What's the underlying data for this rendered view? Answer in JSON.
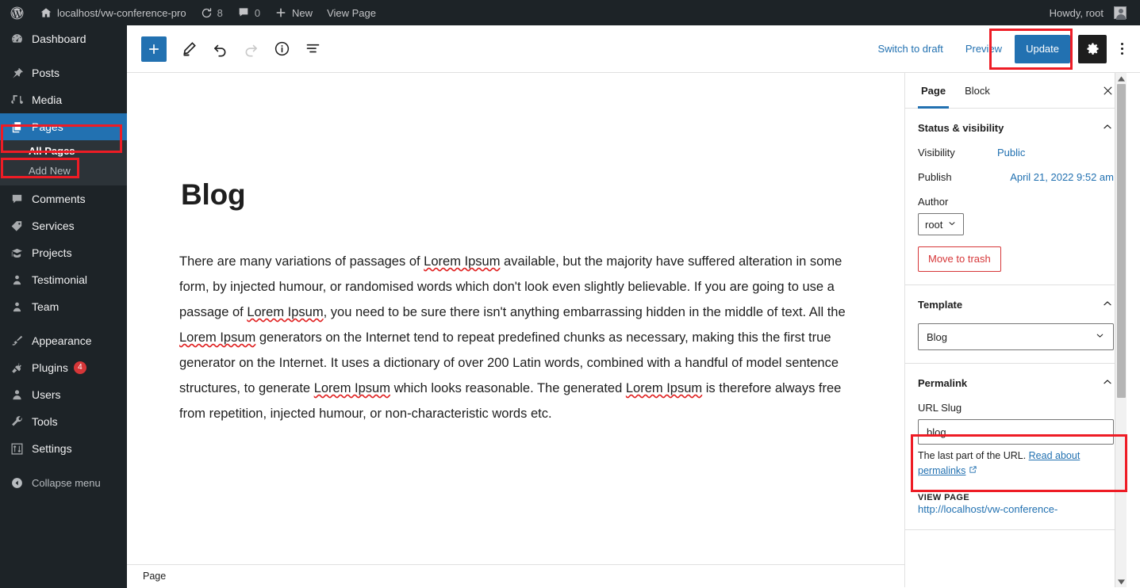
{
  "adminbar": {
    "site_name": "localhost/vw-conference-pro",
    "updates_count": "8",
    "comments_count": "0",
    "new_label": "New",
    "view_page_label": "View Page",
    "howdy": "Howdy, root"
  },
  "adminmenu": {
    "items": [
      {
        "label": "Dashboard",
        "icon": "dashboard-icon"
      },
      {
        "label": "Posts",
        "icon": "pin-icon"
      },
      {
        "label": "Media",
        "icon": "media-icon"
      },
      {
        "label": "Pages",
        "icon": "pages-icon",
        "current": true
      },
      {
        "label": "Comments",
        "icon": "comment-icon"
      },
      {
        "label": "Services",
        "icon": "tag-icon"
      },
      {
        "label": "Projects",
        "icon": "cap-icon"
      },
      {
        "label": "Testimonial",
        "icon": "person-icon"
      },
      {
        "label": "Team",
        "icon": "person-icon"
      },
      {
        "label": "Appearance",
        "icon": "brush-icon"
      },
      {
        "label": "Plugins",
        "icon": "plug-icon",
        "badge": "4"
      },
      {
        "label": "Users",
        "icon": "users-icon"
      },
      {
        "label": "Tools",
        "icon": "wrench-icon"
      },
      {
        "label": "Settings",
        "icon": "sliders-icon"
      }
    ],
    "submenu": [
      {
        "label": "All Pages",
        "current": true
      },
      {
        "label": "Add New",
        "current": false
      }
    ],
    "collapse_label": "Collapse menu"
  },
  "header": {
    "add_block_label": "+",
    "tools": [
      "edit-pencil-icon",
      "undo-icon",
      "redo-icon",
      "info-icon",
      "list-view-icon"
    ],
    "switch_to_draft": "Switch to draft",
    "preview": "Preview",
    "update": "Update",
    "settings_icon": "gear-icon",
    "more_icon": "kebab-menu-icon"
  },
  "editor": {
    "post_title": "Blog",
    "paragraph": {
      "part1": "There are many variations of passages of ",
      "lorem1": "Lorem Ipsum",
      "part2": " available, but the majority have suffered alteration in some form, by injected humour, or randomised words which don't look even slightly believable. If you are going to use a passage of ",
      "lorem2": "Lorem Ipsum",
      "part3": ", you need to be sure there isn't anything embarrassing hidden in the middle of text. All the ",
      "lorem3": "Lorem Ipsum",
      "part4": " generators on the Internet tend to repeat predefined chunks as necessary, making this the first true generator on the Internet. It uses a dictionary of over 200 Latin words, combined with a handful of model sentence structures, to generate ",
      "lorem4": "Lorem Ipsum",
      "part5": " which looks reasonable. The generated ",
      "lorem5": "Lorem Ipsum",
      "part6": " is therefore always free from repetition, injected humour, or non-characteristic words etc."
    },
    "breadcrumb": "Page"
  },
  "sidebar": {
    "tab_page": "Page",
    "tab_block": "Block",
    "close_icon": "close-icon",
    "status": {
      "title": "Status & visibility",
      "visibility_label": "Visibility",
      "visibility_value": "Public",
      "publish_label": "Publish",
      "publish_value": "April 21, 2022 9:52 am",
      "author_label": "Author",
      "author_value": "root",
      "trash_label": "Move to trash"
    },
    "template": {
      "title": "Template",
      "value": "Blog"
    },
    "permalink": {
      "title": "Permalink",
      "slug_label": "URL Slug",
      "slug_value": "blog",
      "helper_text": "The last part of the URL. ",
      "helper_link": "Read about permalinks",
      "view_page_caps": "VIEW PAGE",
      "view_url": "http://localhost/vw-conference-"
    }
  },
  "colors": {
    "admin_dark": "#1d2327",
    "admin_submenu": "#2c3338",
    "accent_blue": "#2271b1",
    "danger_red": "#d63638",
    "annotation_red": "#ee1c25"
  }
}
